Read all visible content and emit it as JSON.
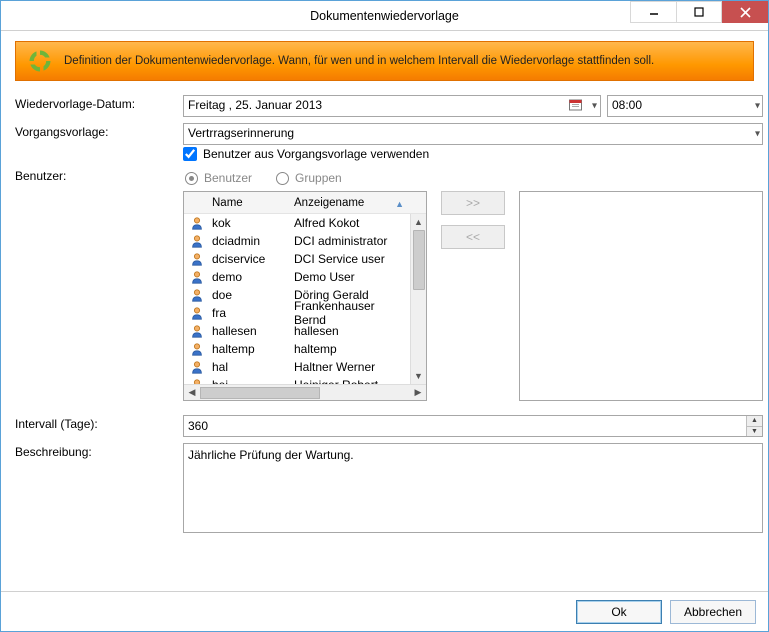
{
  "window": {
    "title": "Dokumentenwiedervorlage"
  },
  "banner": {
    "text": "Definition der Dokumentenwiedervorlage. Wann, für wen und in welchem Intervall die Wiedervorlage stattfinden soll."
  },
  "labels": {
    "date": "Wiedervorlage-Datum:",
    "template": "Vorgangsvorlage:",
    "user": "Benutzer:",
    "interval": "Intervall (Tage):",
    "description": "Beschreibung:"
  },
  "date": {
    "value": "Freitag   , 25.    Januar    2013"
  },
  "time": {
    "value": "08:00"
  },
  "template": {
    "value": "Vertrragserinnerung"
  },
  "useTemplateUsers": {
    "label": "Benutzer aus Vorgangsvorlage verwenden",
    "checked": true
  },
  "userType": {
    "option_user": "Benutzer",
    "option_group": "Gruppen",
    "selected": "user"
  },
  "list": {
    "col_name": "Name",
    "col_display": "Anzeigename",
    "rows": [
      {
        "name": "kok",
        "display": "Alfred Kokot"
      },
      {
        "name": "dciadmin",
        "display": "DCI administrator"
      },
      {
        "name": "dciservice",
        "display": "DCI Service user"
      },
      {
        "name": "demo",
        "display": "Demo User"
      },
      {
        "name": "doe",
        "display": "Döring Gerald"
      },
      {
        "name": "fra",
        "display": "Frankenhauser Bernd"
      },
      {
        "name": "hallesen",
        "display": "hallesen"
      },
      {
        "name": "haltemp",
        "display": "haltemp"
      },
      {
        "name": "hal",
        "display": "Haltner Werner"
      },
      {
        "name": "hei",
        "display": "Heiniger Robert"
      }
    ]
  },
  "moveButtons": {
    "add": ">>",
    "remove": "<<"
  },
  "interval": {
    "value": "360"
  },
  "description": {
    "value": "Jährliche Prüfung der Wartung."
  },
  "footer": {
    "ok": "Ok",
    "cancel": "Abbrechen"
  }
}
